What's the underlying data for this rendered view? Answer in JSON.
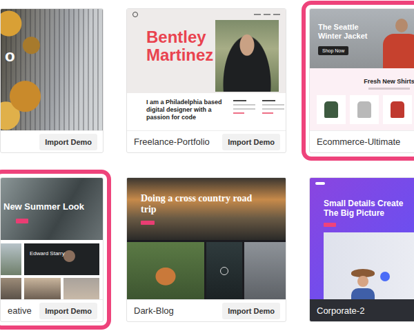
{
  "cards": [
    {
      "kind": "city",
      "name": "",
      "button": "Import Demo",
      "highlighted": false,
      "hovered": false,
      "thumbnail": {
        "heading": "o"
      }
    },
    {
      "kind": "portfolio",
      "name": "Freelance-Portfolio",
      "button": "Import Demo",
      "highlighted": false,
      "hovered": false,
      "thumbnail": {
        "title": "Bentley Martinez",
        "bio": "I am a Philadelphia based digital designer with a passion for code"
      }
    },
    {
      "kind": "ecommerce",
      "name": "Ecommerce-Ultimate",
      "button": "",
      "highlighted": true,
      "hovered": false,
      "thumbnail": {
        "hero": "The Seattle Winter Jacket",
        "cta": "Shop Now",
        "section": "Fresh New Shirts",
        "products": [
          {
            "color": "#3d5a40"
          },
          {
            "color": "#b9b9b9"
          },
          {
            "color": "#c0392f"
          }
        ]
      }
    },
    {
      "kind": "creative",
      "name": "eative",
      "button": "Import Demo",
      "highlighted": true,
      "hovered": false,
      "thumbnail": {
        "hero": "New Summer Look",
        "caption": "Edward Starry"
      }
    },
    {
      "kind": "blog",
      "name": "Dark-Blog",
      "button": "Import Demo",
      "highlighted": false,
      "hovered": false,
      "thumbnail": {
        "title": "Doing a cross country road trip"
      }
    },
    {
      "kind": "corporate",
      "name": "Corporate-2",
      "button": "",
      "highlighted": false,
      "hovered": true,
      "thumbnail": {
        "title": "Small Details Create The Big Picture"
      }
    }
  ]
}
